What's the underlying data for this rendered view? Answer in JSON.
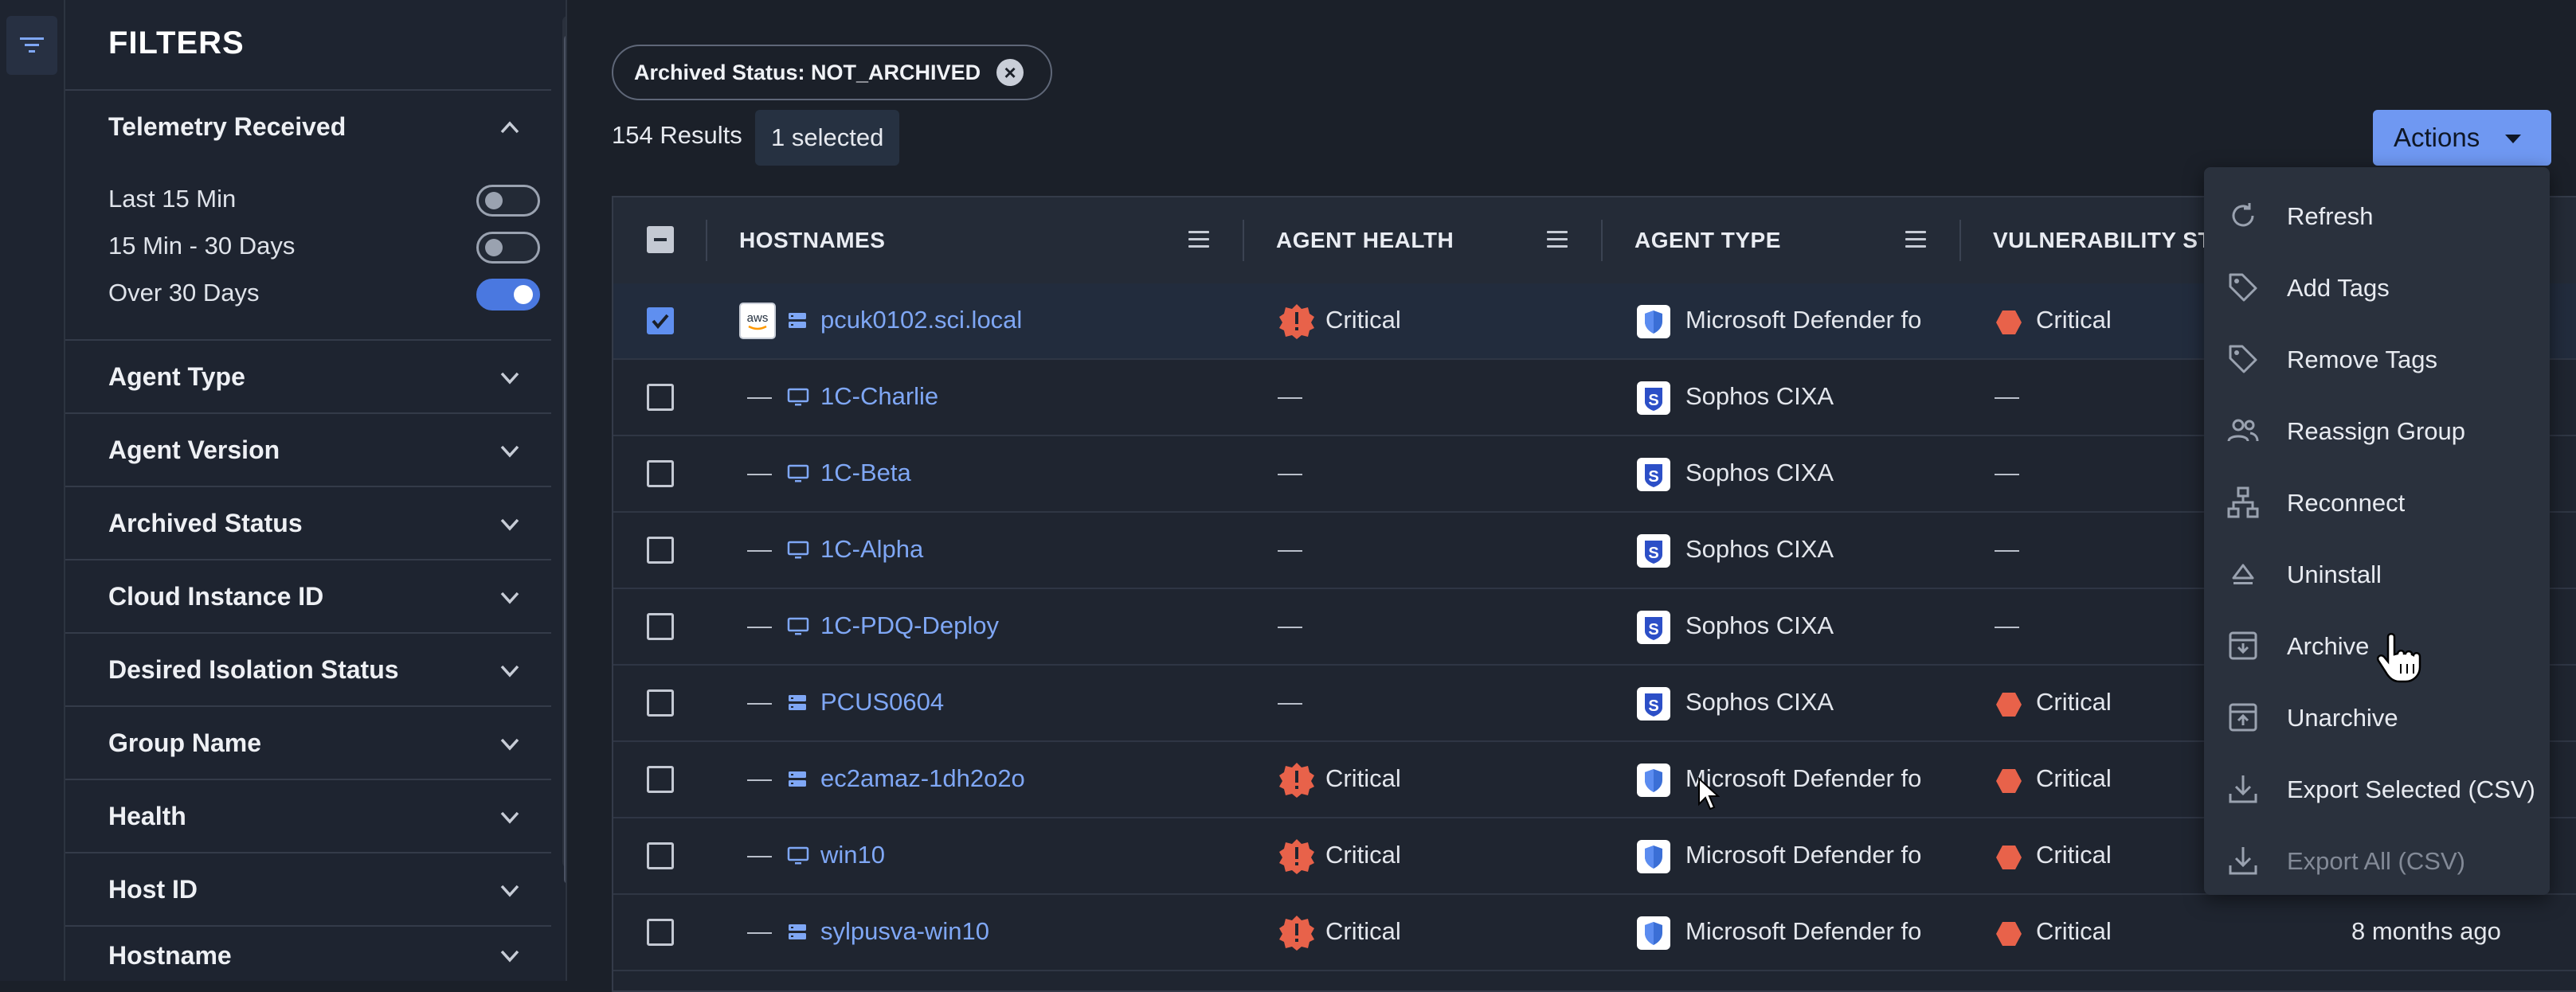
{
  "filters": {
    "title": "FILTERS",
    "telemetry": {
      "label": "Telemetry Received",
      "options": [
        {
          "label": "Last 15 Min",
          "on": false
        },
        {
          "label": "15 Min - 30 Days",
          "on": false
        },
        {
          "label": "Over 30 Days",
          "on": true
        }
      ]
    },
    "sections": [
      "Agent Type",
      "Agent Version",
      "Archived Status",
      "Cloud Instance ID",
      "Desired Isolation Status",
      "Group Name",
      "Health",
      "Host ID",
      "Hostname"
    ]
  },
  "chip": {
    "label": "Archived Status: NOT_ARCHIVED"
  },
  "summary": {
    "results": "154 Results",
    "selected": "1 selected"
  },
  "actions": {
    "label": "Actions"
  },
  "table": {
    "headers": [
      "HOSTNAMES",
      "AGENT HEALTH",
      "AGENT TYPE",
      "VULNERABILITY STA"
    ],
    "rows": [
      {
        "hostname": "pcuk0102.sci.local",
        "prefix": "aws",
        "device": "server",
        "health": "Critical",
        "agent": "Microsoft Defender fo",
        "agent_kind": "defender",
        "vuln": "Critical",
        "checked": true,
        "last_seen": ""
      },
      {
        "hostname": "1C-Charlie",
        "prefix": "—",
        "device": "monitor",
        "health": "—",
        "agent": "Sophos CIXA",
        "agent_kind": "sophos",
        "vuln": "—",
        "checked": false,
        "last_seen": ""
      },
      {
        "hostname": "1C-Beta",
        "prefix": "—",
        "device": "monitor",
        "health": "—",
        "agent": "Sophos CIXA",
        "agent_kind": "sophos",
        "vuln": "—",
        "checked": false,
        "last_seen": ""
      },
      {
        "hostname": "1C-Alpha",
        "prefix": "—",
        "device": "monitor",
        "health": "—",
        "agent": "Sophos CIXA",
        "agent_kind": "sophos",
        "vuln": "—",
        "checked": false,
        "last_seen": ""
      },
      {
        "hostname": "1C-PDQ-Deploy",
        "prefix": "—",
        "device": "monitor",
        "health": "—",
        "agent": "Sophos CIXA",
        "agent_kind": "sophos",
        "vuln": "—",
        "checked": false,
        "last_seen": ""
      },
      {
        "hostname": "PCUS0604",
        "prefix": "—",
        "device": "server",
        "health": "—",
        "agent": "Sophos CIXA",
        "agent_kind": "sophos",
        "vuln": "Critical",
        "checked": false,
        "last_seen": ""
      },
      {
        "hostname": "ec2amaz-1dh2o2o",
        "prefix": "—",
        "device": "server",
        "health": "Critical",
        "agent": "Microsoft Defender fo",
        "agent_kind": "defender",
        "vuln": "Critical",
        "checked": false,
        "last_seen": ""
      },
      {
        "hostname": "win10",
        "prefix": "—",
        "device": "monitor",
        "health": "Critical",
        "agent": "Microsoft Defender fo",
        "agent_kind": "defender",
        "vuln": "Critical",
        "checked": false,
        "last_seen": ""
      },
      {
        "hostname": "sylpusva-win10",
        "prefix": "—",
        "device": "server",
        "health": "Critical",
        "agent": "Microsoft Defender fo",
        "agent_kind": "defender",
        "vuln": "Critical",
        "checked": false,
        "last_seen": "8 months ago"
      }
    ]
  },
  "menu": {
    "items": [
      {
        "label": "Refresh",
        "icon": "refresh-icon",
        "disabled": false
      },
      {
        "label": "Add Tags",
        "icon": "tag-icon",
        "disabled": false
      },
      {
        "label": "Remove Tags",
        "icon": "tag-icon",
        "disabled": false
      },
      {
        "label": "Reassign Group",
        "icon": "users-icon",
        "disabled": false
      },
      {
        "label": "Reconnect",
        "icon": "network-icon",
        "disabled": false
      },
      {
        "label": "Uninstall",
        "icon": "eject-icon",
        "disabled": false
      },
      {
        "label": "Archive",
        "icon": "archive-icon",
        "disabled": false
      },
      {
        "label": "Unarchive",
        "icon": "unarchive-icon",
        "disabled": false
      },
      {
        "label": "Export Selected (CSV)",
        "icon": "download-icon",
        "disabled": false
      },
      {
        "label": "Export All (CSV)",
        "icon": "download-icon",
        "disabled": true
      }
    ]
  },
  "colors": {
    "accent": "#6f98f2",
    "critical": "#e8624a",
    "link": "#7fa7f5"
  }
}
